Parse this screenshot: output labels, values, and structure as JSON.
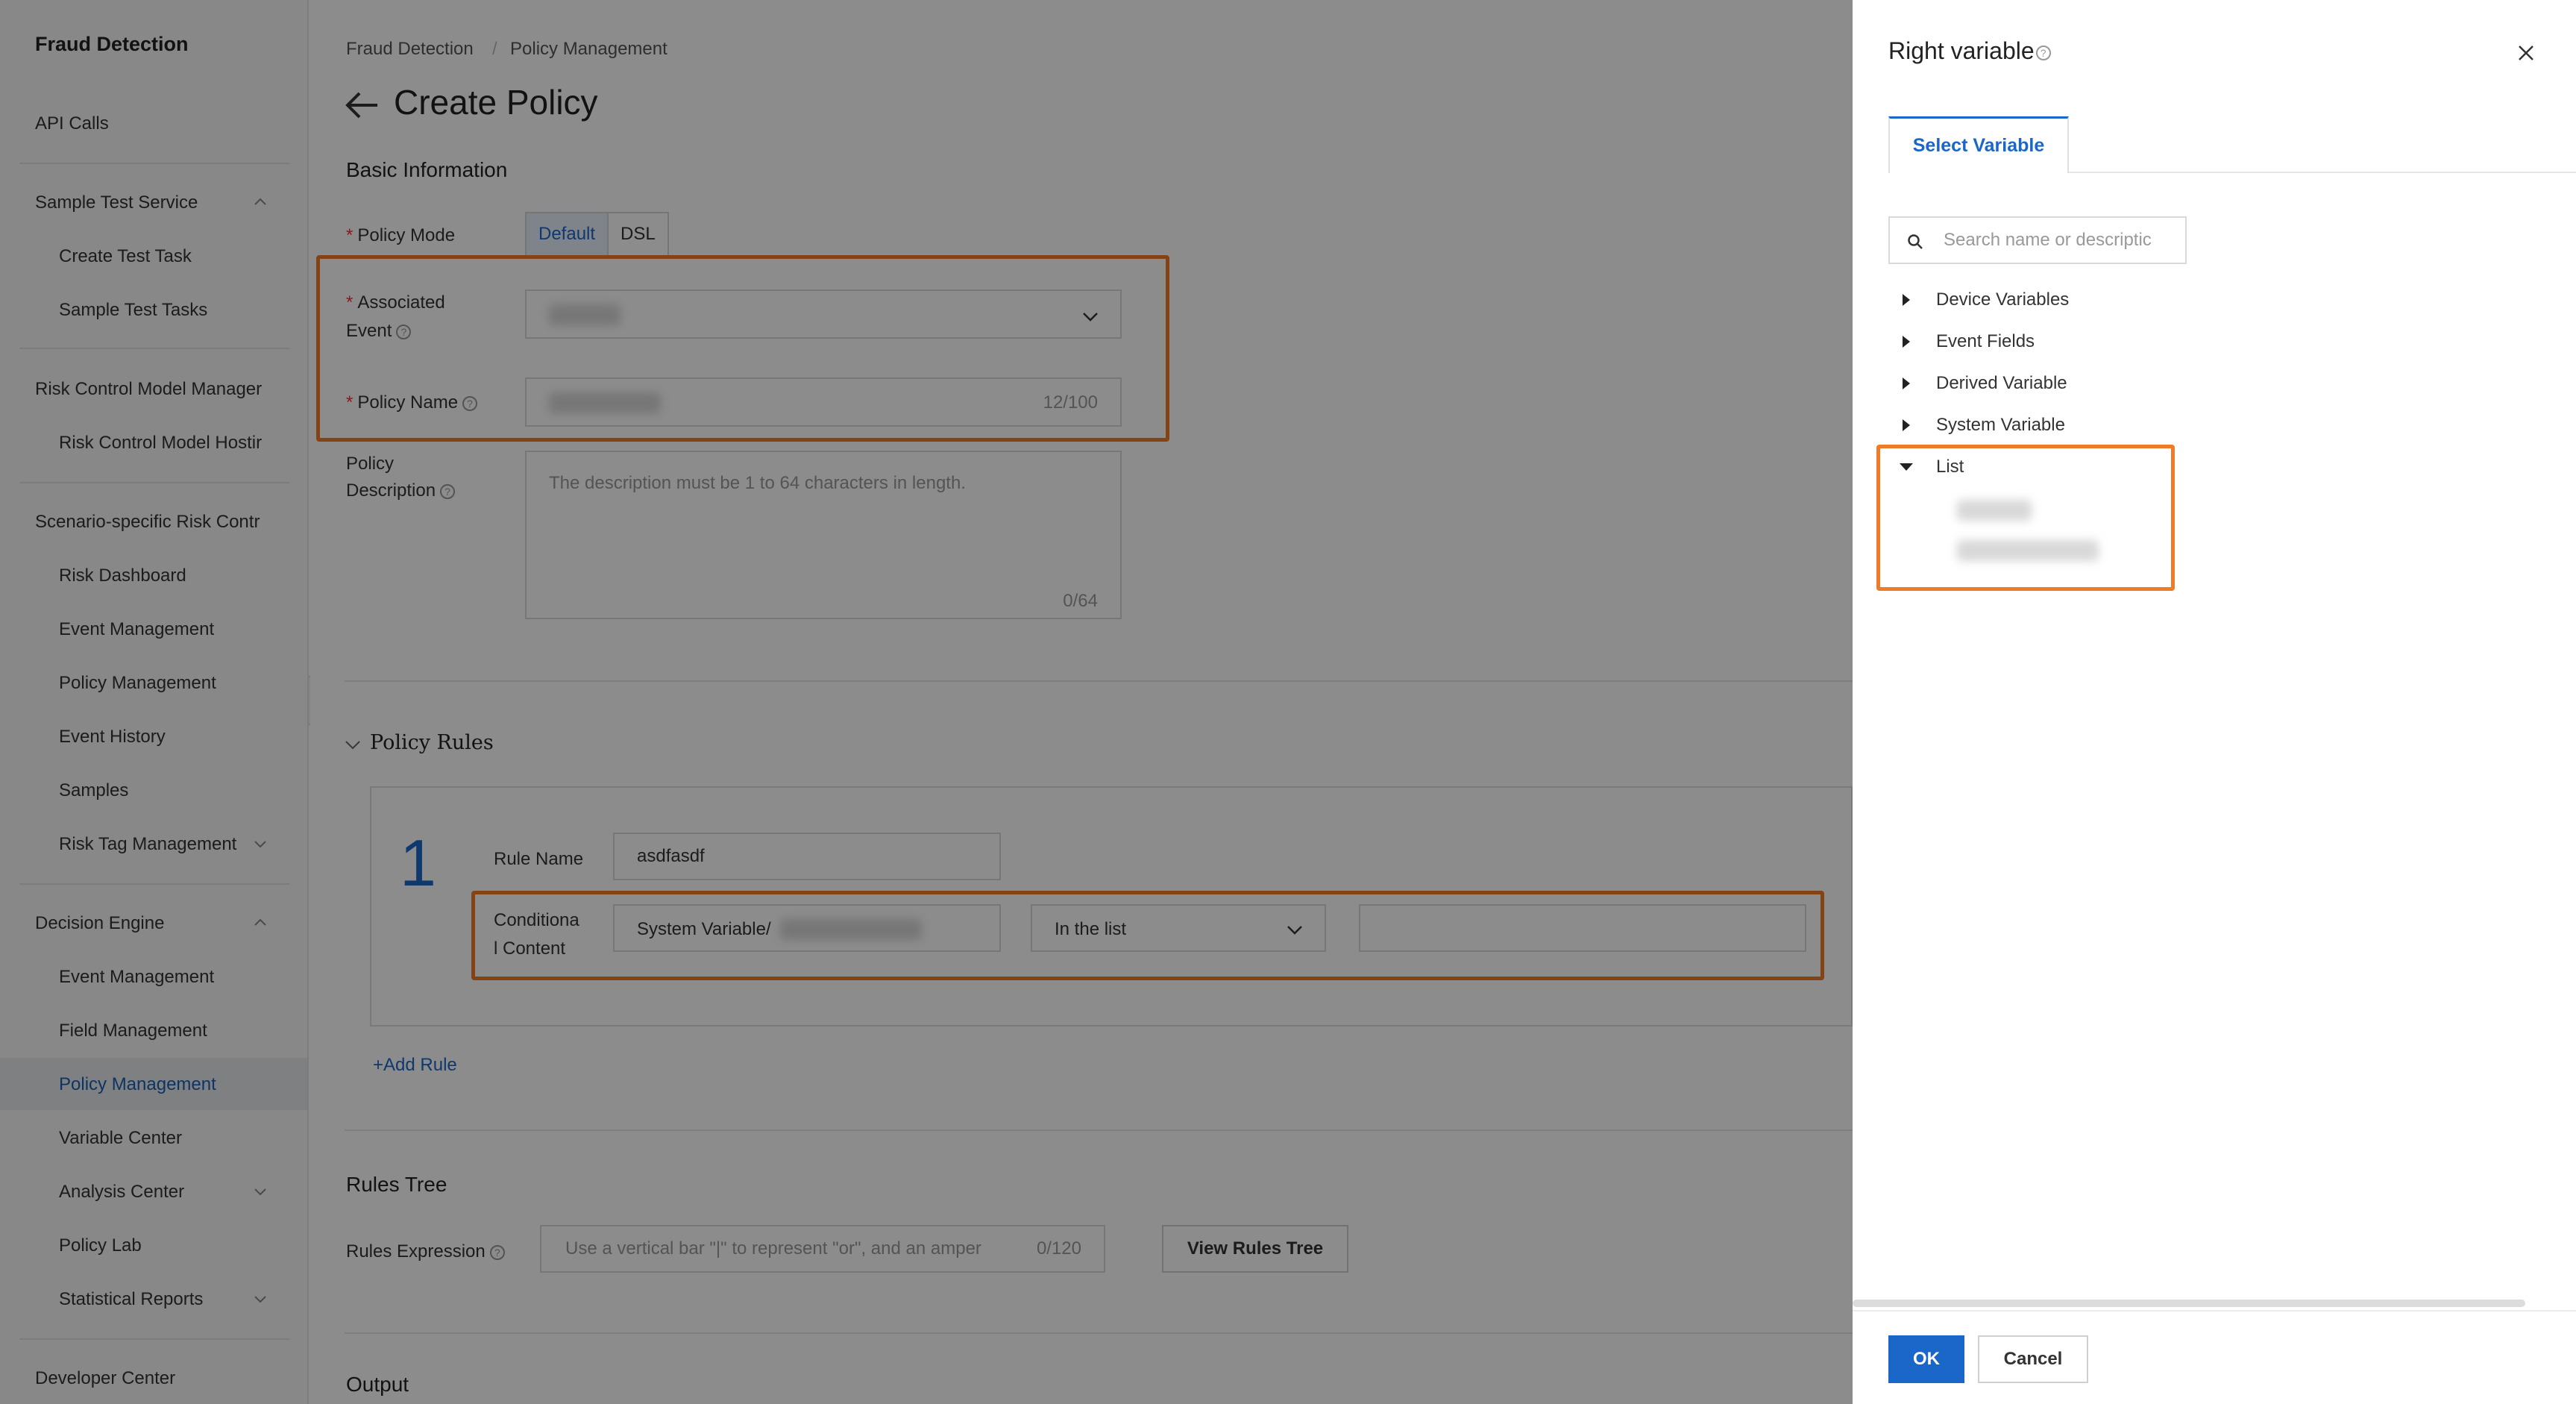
{
  "app": {
    "title": "Fraud Detection"
  },
  "sidebar": {
    "items": [
      {
        "label": "API Calls"
      },
      {
        "label": "Sample Test Service"
      },
      {
        "label": "Create Test Task"
      },
      {
        "label": "Sample Test Tasks"
      },
      {
        "label": "Risk Control Model Manager"
      },
      {
        "label": "Risk Control Model Hostir"
      },
      {
        "label": "Scenario-specific Risk Contr"
      },
      {
        "label": "Risk Dashboard"
      },
      {
        "label": "Event Management"
      },
      {
        "label": "Policy Management"
      },
      {
        "label": "Event History"
      },
      {
        "label": "Samples"
      },
      {
        "label": "Risk Tag Management"
      },
      {
        "label": "Decision Engine"
      },
      {
        "label": "Event Management"
      },
      {
        "label": "Field Management"
      },
      {
        "label": "Policy Management"
      },
      {
        "label": "Variable Center"
      },
      {
        "label": "Analysis Center"
      },
      {
        "label": "Policy Lab"
      },
      {
        "label": "Statistical Reports"
      },
      {
        "label": "Developer Center"
      }
    ]
  },
  "breadcrumb": {
    "items": [
      "Fraud Detection",
      "Policy Management"
    ],
    "separator": "/"
  },
  "page": {
    "title": "Create Policy"
  },
  "basic_info": {
    "section_title": "Basic Information",
    "policy_mode_label": "Policy Mode",
    "policy_mode_options": [
      "Default",
      "DSL"
    ],
    "associated_event_label_1": "Associated",
    "associated_event_label_2": "Event",
    "policy_name_label": "Policy Name",
    "policy_name_count": "12/100",
    "description_label_1": "Policy",
    "description_label_2": "Description",
    "description_placeholder": "The description must be 1 to 64 characters in length.",
    "description_count": "0/64"
  },
  "policy_rules": {
    "section_title": "Policy Rules",
    "rule_number": "1",
    "rule_name_label": "Rule Name",
    "rule_name_value": "asdfasdf",
    "condition_label_1": "Conditiona",
    "condition_label_2": "l Content",
    "condition_left_value": "System Variable/",
    "condition_operator": "In the list",
    "add_rule": "+Add Rule"
  },
  "rules_tree": {
    "section_title": "Rules Tree",
    "expression_label": "Rules Expression",
    "expression_placeholder": "Use a vertical bar \"|\" to represent \"or\", and an amper",
    "expression_count": "0/120",
    "view_button": "View Rules Tree"
  },
  "output": {
    "section_title": "Output"
  },
  "drawer": {
    "title": "Right variable",
    "tab": "Select Variable",
    "search_placeholder": "Search name or descriptic",
    "tree": [
      "Device Variables",
      "Event Fields",
      "Derived Variable",
      "System Variable",
      "List"
    ],
    "ok": "OK",
    "cancel": "Cancel"
  },
  "colors": {
    "accent": "#1a66c9",
    "highlight": "#ef7a27",
    "required": "#e53935"
  }
}
